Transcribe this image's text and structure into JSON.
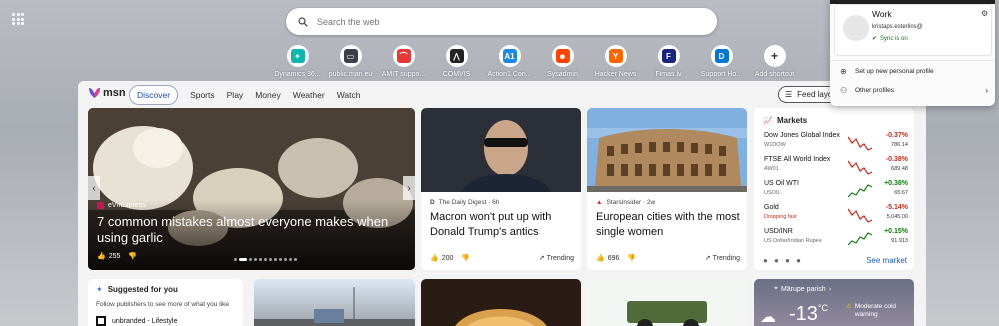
{
  "search": {
    "placeholder": "Search the web"
  },
  "shortcuts": [
    {
      "label": "Dynamics 36...",
      "icon": "dynamics-icon",
      "color": "#0fb5ae",
      "glyph": "✦"
    },
    {
      "label": "public.man.eu",
      "icon": "man-icon",
      "color": "#3b3f4a",
      "glyph": "▭"
    },
    {
      "label": "AMIT suppo...",
      "icon": "amit-icon",
      "color": "#e53935",
      "glyph": "⌒"
    },
    {
      "label": "COMVIS",
      "icon": "comvis-icon",
      "color": "#222222",
      "glyph": "⋀"
    },
    {
      "label": "Action1 Con...",
      "icon": "action1-icon",
      "color": "#1e88e5",
      "glyph": "A1"
    },
    {
      "label": "Sysadmin",
      "icon": "reddit-icon",
      "color": "#ff4500",
      "glyph": "☻"
    },
    {
      "label": "Hacker News",
      "icon": "hackernews-icon",
      "color": "#ff6600",
      "glyph": "Y"
    },
    {
      "label": "Fimas.lv",
      "icon": "fimas-icon",
      "color": "#1a237e",
      "glyph": "F"
    },
    {
      "label": "Support Ho...",
      "icon": "dell-icon",
      "color": "#0076ce",
      "glyph": "D"
    },
    {
      "label": "Add shortcut",
      "icon": "plus-icon",
      "color": "#ffffff",
      "glyph": "+"
    }
  ],
  "msn": {
    "logo": "msn",
    "nav": [
      "Discover",
      "Sports",
      "Play",
      "Money",
      "Weather",
      "Watch"
    ],
    "feed_button": "Feed layo"
  },
  "hero": {
    "source": "eVnExpress",
    "title": "7 common mistakes almost everyone makes when using garlic",
    "likes": "255"
  },
  "news": [
    {
      "source": "The Daily Digest · 6h",
      "title": "Macron won't put up with Donald Trump's antics",
      "likes": "200",
      "trend": "Trending"
    },
    {
      "source": "StarsInsider · 2w",
      "title": "European cities with the most single women",
      "likes": "696",
      "trend": "Trending"
    }
  ],
  "markets": {
    "title": "Markets",
    "rows": [
      {
        "name": "Dow Jones Global Index",
        "sub": "W1DOW",
        "change": "-0.37%",
        "value": "786.14",
        "dir": "neg",
        "sub_alert": false
      },
      {
        "name": "FTSE All World Index",
        "sub": "AW01",
        "change": "-0.38%",
        "value": "689.48",
        "dir": "neg",
        "sub_alert": false
      },
      {
        "name": "US Oil WTI",
        "sub": "USOIL",
        "change": "+0.38%",
        "value": "65.67",
        "dir": "pos",
        "sub_alert": false
      },
      {
        "name": "Gold",
        "sub": "Dropping fast",
        "change": "-5.14%",
        "value": "5,045.00",
        "dir": "neg",
        "sub_alert": true
      },
      {
        "name": "USD/INR",
        "sub": "US Dollar/Indian Rupee",
        "change": "+0.15%",
        "value": "91.913",
        "dir": "pos",
        "sub_alert": false
      }
    ],
    "see_more": "See market"
  },
  "suggested": {
    "title": "Suggested for you",
    "text": "Follow publishers to see more of what you like",
    "publisher": "unbranded - Lifestyle"
  },
  "weather": {
    "location": "Mārupe parish",
    "temp": "-13",
    "unit": "°C",
    "alert": "Moderate cold warning"
  },
  "profile": {
    "name": "Work",
    "email": "kristaps.esterlins@",
    "sync": "Sync is on",
    "items": [
      "Set up new personal profile",
      "Other profiles"
    ]
  }
}
